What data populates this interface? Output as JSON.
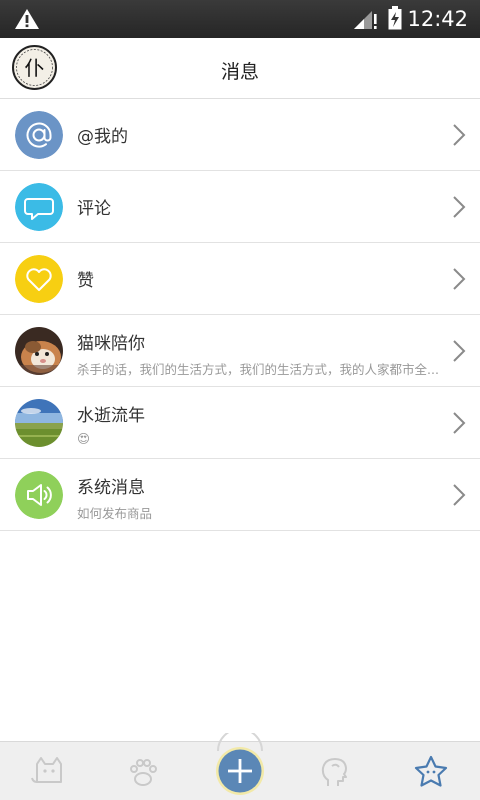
{
  "status_bar": {
    "time": "12:42",
    "icons": [
      "warning-icon",
      "signal-icon",
      "battery-icon"
    ]
  },
  "header": {
    "title": "消息"
  },
  "messages": [
    {
      "name": "@我的",
      "sub": "",
      "icon": "at-icon",
      "color": "#6b94c6"
    },
    {
      "name": "评论",
      "sub": "",
      "icon": "comment-icon",
      "color": "#3bbbe6"
    },
    {
      "name": "赞",
      "sub": "",
      "icon": "heart-icon",
      "color": "#f7cf12"
    },
    {
      "name": "猫咪陪你",
      "sub": "杀手的话，我们的生活方式，我们的生活方式，我的人家都市全...",
      "icon": "cat-avatar"
    },
    {
      "name": "水逝流年",
      "sub": "😍",
      "icon": "landscape-avatar"
    },
    {
      "name": "系统消息",
      "sub": "如何发布商品",
      "icon": "speaker-icon",
      "color": "#8fd05a"
    }
  ],
  "tabbar": {
    "tabs": [
      "cat-tab-icon",
      "paw-tab-icon",
      "add-tab-icon",
      "head-tab-icon",
      "star-tab-icon"
    ],
    "active": "star-tab-icon"
  }
}
